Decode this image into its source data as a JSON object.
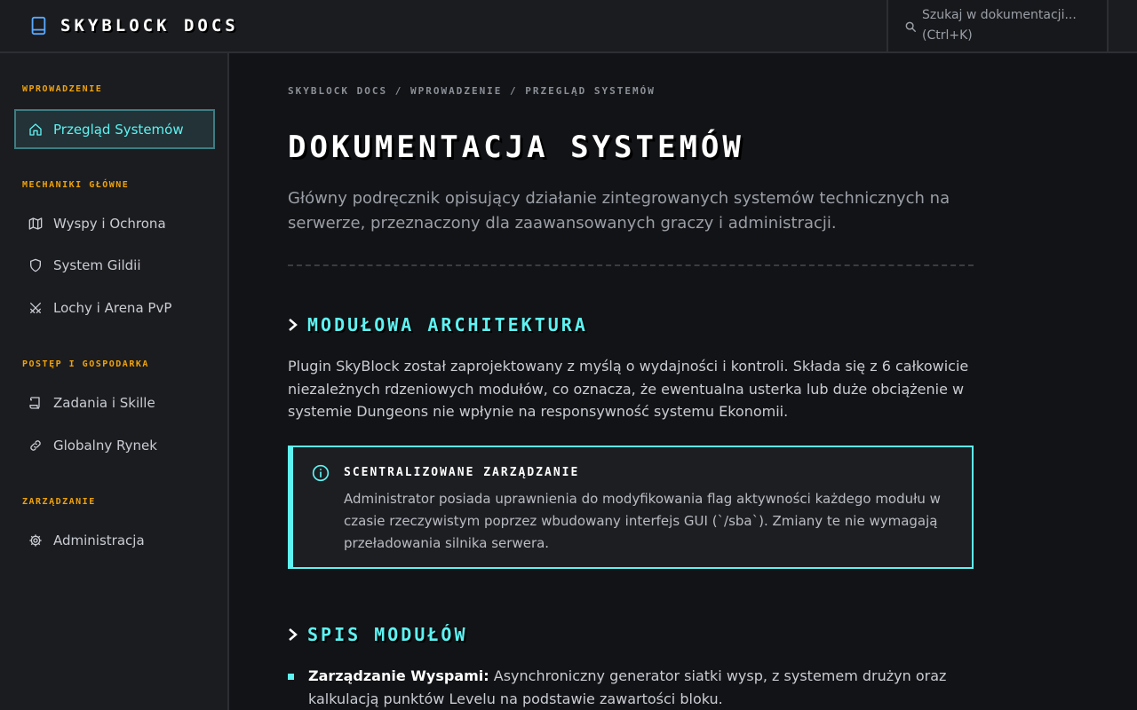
{
  "header": {
    "brand": "SKYBLOCK DOCS",
    "search_placeholder": "Szukaj w dokumentacji... (Ctrl+K)"
  },
  "sidebar": {
    "sections": [
      {
        "heading": "WPROWADZENIE",
        "items": [
          {
            "label": "Przegląd Systemów",
            "icon": "home-icon",
            "active": true
          }
        ]
      },
      {
        "heading": "MECHANIKI GŁÓWNE",
        "items": [
          {
            "label": "Wyspy i Ochrona",
            "icon": "map-icon"
          },
          {
            "label": "System Gildii",
            "icon": "shield-icon"
          },
          {
            "label": "Lochy i Arena PvP",
            "icon": "swords-icon"
          }
        ]
      },
      {
        "heading": "POSTĘP I GOSPODARKA",
        "items": [
          {
            "label": "Zadania i Skille",
            "icon": "scroll-icon"
          },
          {
            "label": "Globalny Rynek",
            "icon": "link-icon"
          }
        ]
      },
      {
        "heading": "ZARZĄDZANIE",
        "items": [
          {
            "label": "Administracja",
            "icon": "gear-icon"
          }
        ]
      }
    ]
  },
  "main": {
    "breadcrumb": "SKYBLOCK DOCS / WPROWADZENIE / PRZEGLĄD SYSTEMÓW",
    "title": "DOKUMENTACJA SYSTEMÓW",
    "lead": "Główny podręcznik opisujący działanie zintegrowanych systemów technicznych na serwerze, przeznaczony dla zaawansowanych graczy i administracji.",
    "section1_title": "MODUŁOWA ARCHITEKTURA",
    "section1_body": "Plugin SkyBlock został zaprojektowany z myślą o wydajności i kontroli. Składa się z 6 całkowicie niezależnych rdzeniowych modułów, co oznacza, że ewentualna usterka lub duże obciążenie w systemie Dungeons nie wpłynie na responsywność systemu Ekonomii.",
    "callout": {
      "title": "SCENTRALIZOWANE ZARZĄDZANIE",
      "body": "Administrator posiada uprawnienia do modyfikowania flag aktywności każdego modułu w czasie rzeczywistym poprzez wbudowany interfejs GUI (`/sba`). Zmiany te nie wymagają przeładowania silnika serwera."
    },
    "section2_title": "SPIS MODUŁÓW",
    "modules": [
      {
        "name": "Zarządzanie Wyspami:",
        "desc": "Asynchroniczny generator siatki wysp, z systemem drużyn oraz kalkulacją punktów Levelu na podstawie zawartości bloku."
      }
    ]
  },
  "colors": {
    "accent": "#5ef2f2",
    "heading": "#f0a20b",
    "background": "#121316",
    "panel": "#1b1c20"
  }
}
